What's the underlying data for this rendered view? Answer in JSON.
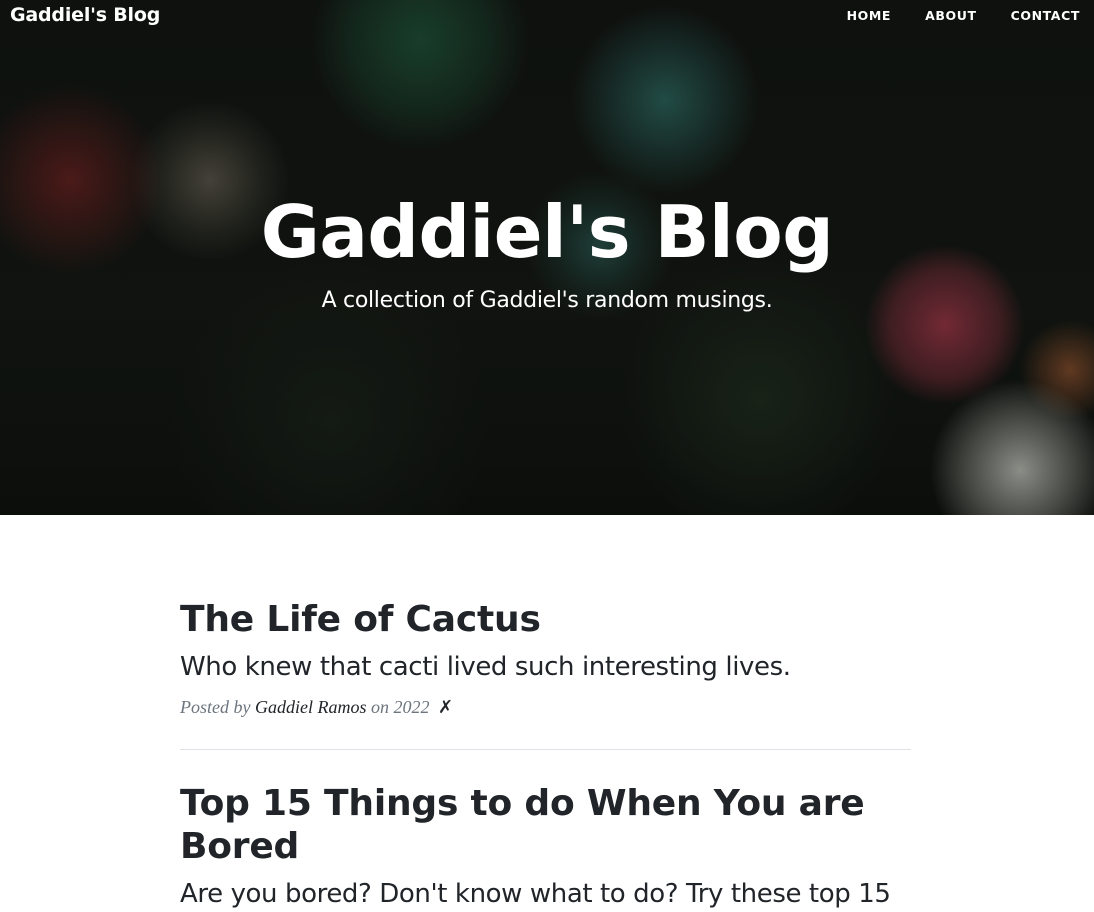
{
  "nav": {
    "brand": "Gaddiel's Blog",
    "links": [
      "HOME",
      "ABOUT",
      "CONTACT"
    ]
  },
  "hero": {
    "title": "Gaddiel's Blog",
    "subtitle": "A collection of Gaddiel's random musings."
  },
  "posts": [
    {
      "title": "The Life of Cactus",
      "subtitle": "Who knew that cacti lived such interesting lives.",
      "meta_prefix": "Posted by ",
      "author": "Gaddiel Ramos",
      "meta_on": " on 2022 ",
      "delete_glyph": "✗"
    },
    {
      "title": "Top 15 Things to do When You are Bored",
      "subtitle": "Are you bored? Don't know what to do? Try these top 15"
    }
  ],
  "colors": {
    "text_dark": "#212529",
    "text_muted": "#6c757d",
    "divider": "#dee2e6"
  }
}
